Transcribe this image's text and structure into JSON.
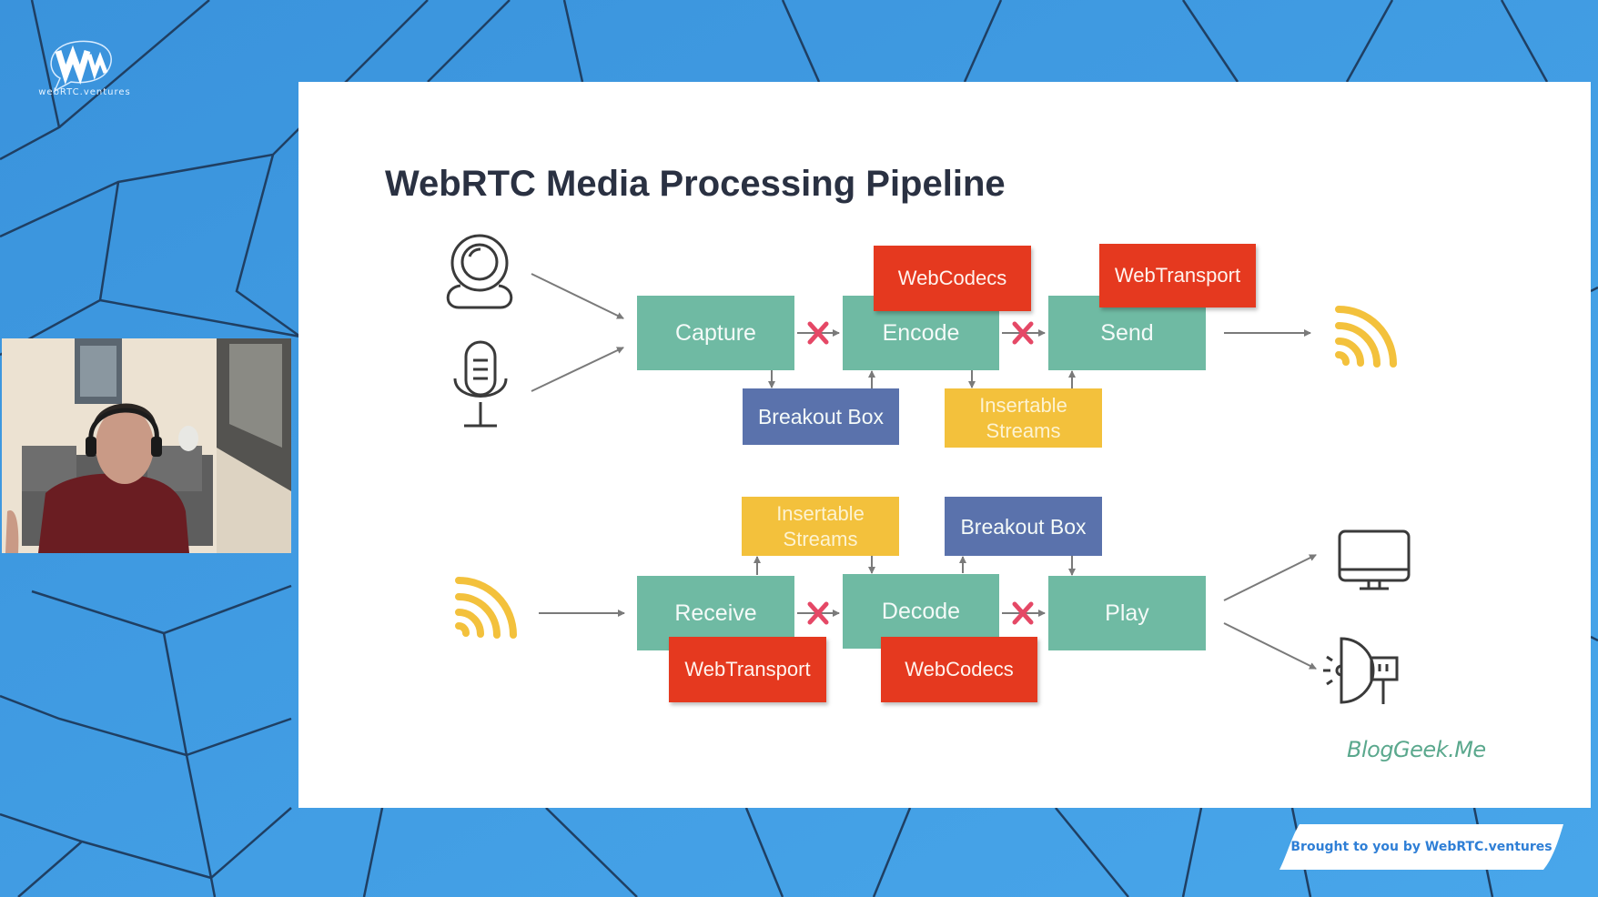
{
  "branding": {
    "logo_text": "webRTC.ventures",
    "footer_banner": "Brought to you by WebRTC.ventures"
  },
  "webcam": {
    "label": "presenter-video"
  },
  "slide": {
    "title": "WebRTC Media Processing Pipeline",
    "watermark": "BlogGeek.Me",
    "send_pipeline": {
      "sources": [
        "camera-icon",
        "microphone-icon"
      ],
      "stages": [
        "Capture",
        "Encode",
        "Send"
      ],
      "apis_above": [
        "WebCodecs",
        "WebTransport"
      ],
      "hooks_below": [
        "Breakout Box",
        "Insertable Streams"
      ],
      "destination": "wifi-icon"
    },
    "receive_pipeline": {
      "source": "wifi-icon",
      "stages": [
        "Receive",
        "Decode",
        "Play"
      ],
      "hooks_above": [
        "Insertable Streams",
        "Breakout Box"
      ],
      "apis_below": [
        "WebTransport",
        "WebCodecs"
      ],
      "destinations": [
        "monitor-icon",
        "speaker-icon"
      ]
    },
    "colors": {
      "stage": "#6fbaa3",
      "breakout": "#5a72ac",
      "insertable": "#f3c13c",
      "api": "#e5391f",
      "cross": "#e54866",
      "signal": "#f3c13c"
    }
  }
}
